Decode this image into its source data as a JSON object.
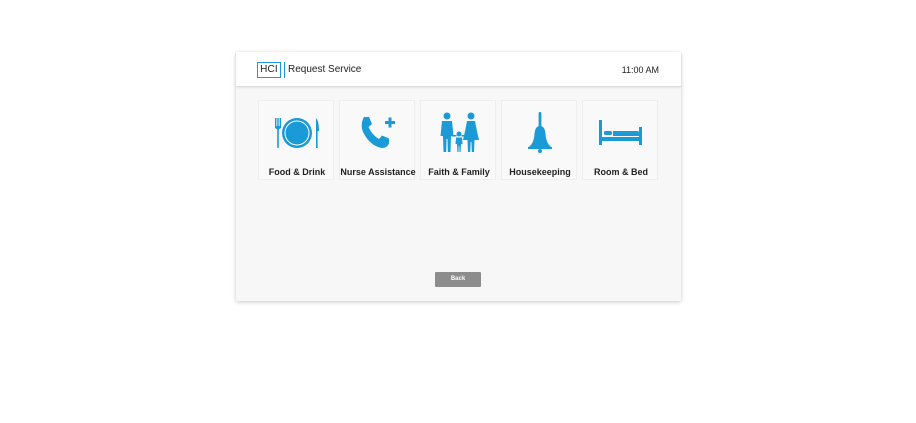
{
  "header": {
    "logo_text": "HCI",
    "title": "Request Service",
    "time": "11:00 AM"
  },
  "tiles": [
    {
      "label": "Food & Drink",
      "icon": "plate-cutlery-icon"
    },
    {
      "label": "Nurse Assistance",
      "icon": "phone-plus-icon"
    },
    {
      "label": "Faith & Family",
      "icon": "family-icon"
    },
    {
      "label": "Housekeeping",
      "icon": "bell-icon"
    },
    {
      "label": "Room & Bed",
      "icon": "bed-icon"
    }
  ],
  "back_label": "Back",
  "colors": {
    "accent": "#1a9ad6",
    "button": "#8d8d8d"
  }
}
